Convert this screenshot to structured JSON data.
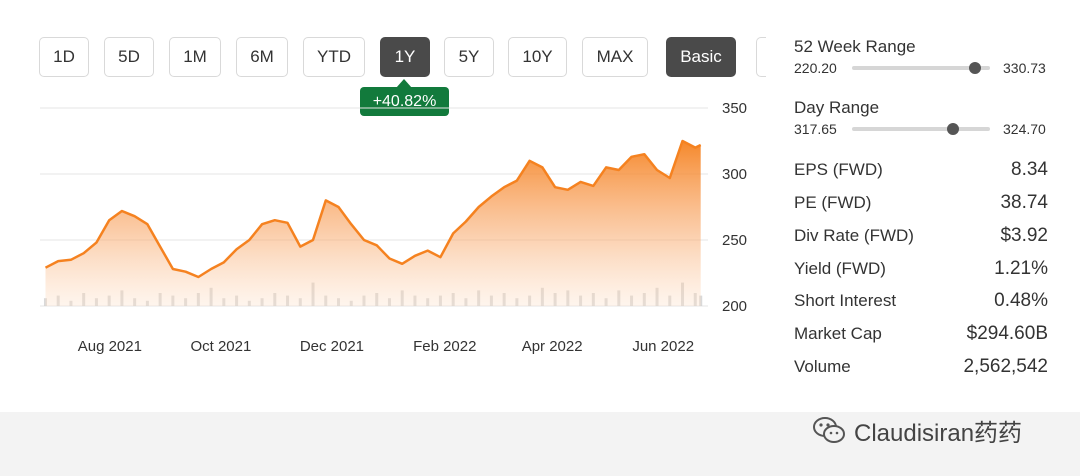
{
  "toolbar": {
    "ranges": [
      {
        "label": "1D",
        "active": false
      },
      {
        "label": "5D",
        "active": false
      },
      {
        "label": "1M",
        "active": false
      },
      {
        "label": "6M",
        "active": false
      },
      {
        "label": "YTD",
        "active": false
      },
      {
        "label": "1Y",
        "active": true
      },
      {
        "label": "5Y",
        "active": false
      },
      {
        "label": "10Y",
        "active": false
      },
      {
        "label": "MAX",
        "active": false
      },
      {
        "label": "Basic",
        "active": true
      }
    ]
  },
  "change_badge": "+40.82%",
  "colors": {
    "accent_orange": "#f58220",
    "badge_green": "#127a3c",
    "active_button": "#4a4a4a"
  },
  "chart_data": {
    "type": "area",
    "title": "",
    "xlabel": "",
    "ylabel": "",
    "ylim": [
      200,
      350
    ],
    "yticks": [
      350,
      300,
      250,
      200
    ],
    "xticks": [
      "Aug 2021",
      "Oct 2021",
      "Dec 2021",
      "Feb 2022",
      "Apr 2022",
      "Jun 2022"
    ],
    "grid": true,
    "legend": "none",
    "series": [
      {
        "x": [
          "2021-07-12",
          "2021-07-19",
          "2021-07-26",
          "2021-08-02",
          "2021-08-09",
          "2021-08-16",
          "2021-08-23",
          "2021-08-30",
          "2021-09-06",
          "2021-09-13",
          "2021-09-20",
          "2021-09-27",
          "2021-10-04",
          "2021-10-11",
          "2021-10-18",
          "2021-10-25",
          "2021-11-01",
          "2021-11-08",
          "2021-11-15",
          "2021-11-22",
          "2021-11-29",
          "2021-12-06",
          "2021-12-13",
          "2021-12-20",
          "2021-12-27",
          "2022-01-03",
          "2022-01-10",
          "2022-01-17",
          "2022-01-24",
          "2022-01-31",
          "2022-02-07",
          "2022-02-14",
          "2022-02-21",
          "2022-02-28",
          "2022-03-07",
          "2022-03-14",
          "2022-03-21",
          "2022-03-28",
          "2022-04-04",
          "2022-04-11",
          "2022-04-18",
          "2022-04-25",
          "2022-05-02",
          "2022-05-09",
          "2022-05-16",
          "2022-05-23",
          "2022-05-30",
          "2022-06-06",
          "2022-06-13",
          "2022-06-20",
          "2022-06-27",
          "2022-07-04",
          "2022-07-07"
        ],
        "values": [
          229,
          234,
          235,
          240,
          248,
          265,
          272,
          268,
          262,
          245,
          228,
          226,
          222,
          228,
          233,
          243,
          250,
          262,
          265,
          263,
          245,
          250,
          280,
          275,
          262,
          250,
          246,
          236,
          232,
          238,
          242,
          237,
          255,
          264,
          275,
          283,
          290,
          295,
          310,
          305,
          290,
          288,
          294,
          291,
          305,
          303,
          313,
          315,
          303,
          297,
          325,
          320,
          322
        ]
      }
    ],
    "volume": [
      0.3,
      0.4,
      0.2,
      0.5,
      0.3,
      0.4,
      0.6,
      0.3,
      0.2,
      0.5,
      0.4,
      0.3,
      0.5,
      0.7,
      0.3,
      0.4,
      0.2,
      0.3,
      0.5,
      0.4,
      0.3,
      0.9,
      0.4,
      0.3,
      0.2,
      0.4,
      0.5,
      0.3,
      0.6,
      0.4,
      0.3,
      0.4,
      0.5,
      0.3,
      0.6,
      0.4,
      0.5,
      0.3,
      0.4,
      0.7,
      0.5,
      0.6,
      0.4,
      0.5,
      0.3,
      0.6,
      0.4,
      0.5,
      0.7,
      0.4,
      0.9,
      0.5,
      0.4
    ]
  },
  "stats": {
    "week52": {
      "label": "52 Week Range",
      "min": "220.20",
      "max": "330.73",
      "position": 0.89
    },
    "day": {
      "label": "Day Range",
      "min": "317.65",
      "max": "324.70",
      "position": 0.73
    },
    "rows": [
      {
        "label": "EPS (FWD)",
        "value": "8.34"
      },
      {
        "label": "PE (FWD)",
        "value": "38.74"
      },
      {
        "label": "Div Rate (FWD)",
        "value": "$3.92"
      },
      {
        "label": "Yield (FWD)",
        "value": "1.21%"
      },
      {
        "label": "Short Interest",
        "value": "0.48%"
      },
      {
        "label": "Market Cap",
        "value": "$294.60B"
      },
      {
        "label": "Volume",
        "value": "2,562,542"
      }
    ]
  },
  "watermark": {
    "icon": "wechat-icon",
    "text": "Claudisiran药药"
  }
}
